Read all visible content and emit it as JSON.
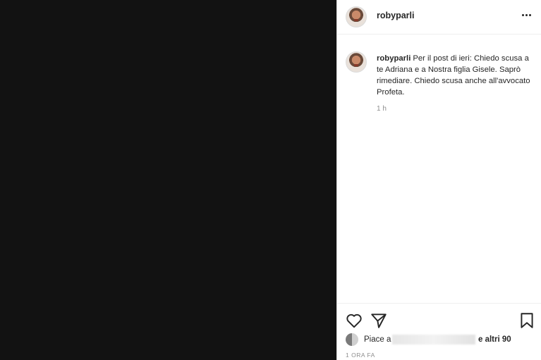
{
  "post": {
    "username": "robyparli",
    "caption": "Per il post di ieri: Chiedo scusa a te Adriana e a Nostra figlia Gisele. Saprò rimediare. Chiedo scusa anche all'avvocato Profeta.",
    "caption_time": "1 h",
    "likes_prefix": "Piace a",
    "likes_suffix": "e altri 90",
    "timestamp": "1 ORA FA"
  },
  "icons": {
    "more": "more-options-icon",
    "like": "heart-icon",
    "share": "paper-plane-icon",
    "save": "bookmark-icon"
  },
  "colors": {
    "photo_background": "#121212",
    "text": "#262626",
    "secondary_text": "#8e8e8e",
    "border": "#dbdbdb"
  }
}
